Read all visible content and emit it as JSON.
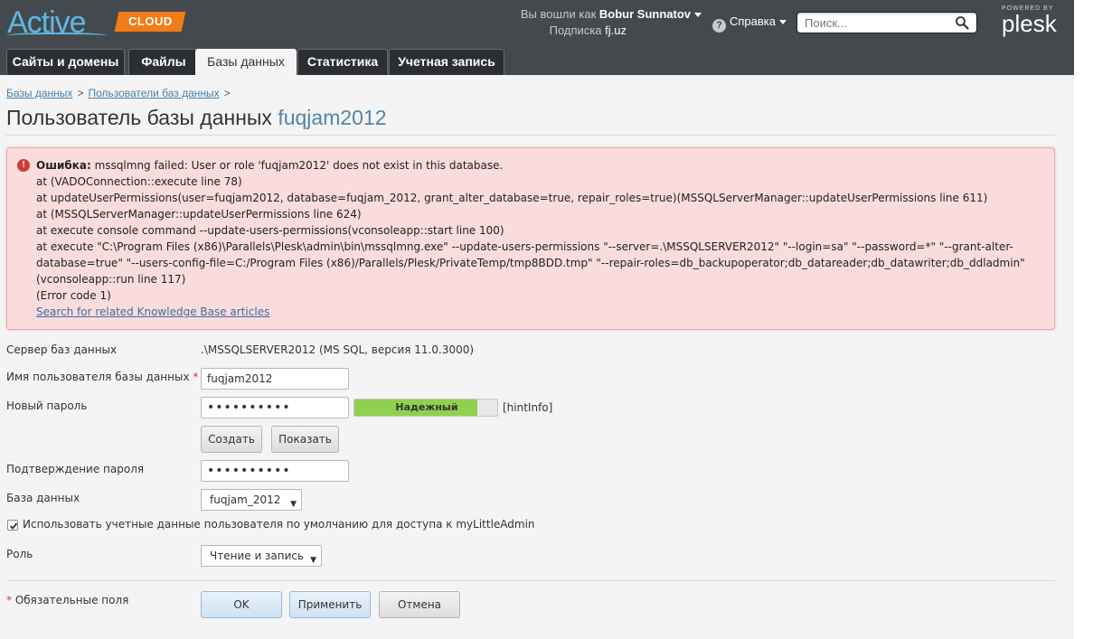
{
  "brand": {
    "logo_text": "Active",
    "cloud_badge": "CLOUD",
    "powered_by": "POWERED BY",
    "plesk": "plesk"
  },
  "header": {
    "logged_in_label": "Вы вошли как",
    "user_name": "Bobur Sunnatov",
    "subscription_label": "Подписка",
    "subscription_value": "fj.uz",
    "help_label": "Справка",
    "search_placeholder": "Поиск..."
  },
  "tabs": [
    {
      "label": "Сайты и домены",
      "active": false
    },
    {
      "label": "Файлы",
      "active": false
    },
    {
      "label": "Базы данных",
      "active": true
    },
    {
      "label": "Статистика",
      "active": false
    },
    {
      "label": "Учетная запись",
      "active": false
    }
  ],
  "breadcrumb": {
    "items": [
      "Базы данных",
      "Пользователи баз данных"
    ],
    "separator": ">"
  },
  "page": {
    "title_prefix": "Пользователь базы данных",
    "title_name": "fuqjam2012"
  },
  "error": {
    "heading": "Ошибка:",
    "message": "mssqlmng failed: User or role 'fuqjam2012' does not exist in this database.",
    "lines": [
      "at (VADOConnection::execute line 78)",
      "at updateUserPermissions(user=fuqjam2012, database=fuqjam_2012, grant_alter_database=true, repair_roles=true)(MSSQLServerManager::updateUserPermissions line 611)",
      "at (MSSQLServerManager::updateUserPermissions line 624)",
      "at execute console command --update-users-permissions(vconsoleapp::start line 100)",
      "at execute \"C:\\Program Files (x86)\\Parallels\\Plesk\\admin\\bin\\mssqlmng.exe\" --update-users-permissions \"--server=.\\MSSQLSERVER2012\" \"--login=sa\" \"--password=*\" \"--grant-alter-database=true\" \"--users-config-file=C:/Program Files (x86)/Parallels/Plesk/PrivateTemp/tmp8BDD.tmp\" \"--repair-roles=db_backupoperator;db_datareader;db_datawriter;db_ddladmin\"(vconsoleapp::run line 117)",
      "(Error code 1)"
    ],
    "kb_link": "Search for related Knowledge Base articles"
  },
  "form": {
    "server_label": "Сервер баз данных",
    "server_value": ".\\MSSQLSERVER2012 (MS SQL, версия 11.0.3000)",
    "username_label": "Имя пользователя базы данных",
    "required_mark": "*",
    "username_value": "fuqjam2012",
    "password_label": "Новый пароль",
    "password_value": "••••••••••",
    "strength_label": "Надежный",
    "strength_fraction": 0.86,
    "hint": "[hintInfo]",
    "generate_button": "Создать",
    "show_button": "Показать",
    "confirm_label": "Подтверждение пароля",
    "confirm_value": "••••••••••",
    "database_label": "База данных",
    "database_value": "fuqjam_2012",
    "use_default_label": "Использовать учетные данные пользователя по умолчанию для доступа к myLittleAdmin",
    "use_default_checked": true,
    "role_label": "Роль",
    "role_value": "Чтение и запись",
    "required_note": "Обязательные поля"
  },
  "buttons": {
    "ok": "OK",
    "apply": "Применить",
    "cancel": "Отмена"
  },
  "colors": {
    "header_bg": "#44494e",
    "accent_blue": "#5fb6e6",
    "cloud_orange": "#f07d17",
    "error_bg": "#fadcdc",
    "strength_green": "#8fd14f",
    "link": "#4a7fa8"
  }
}
